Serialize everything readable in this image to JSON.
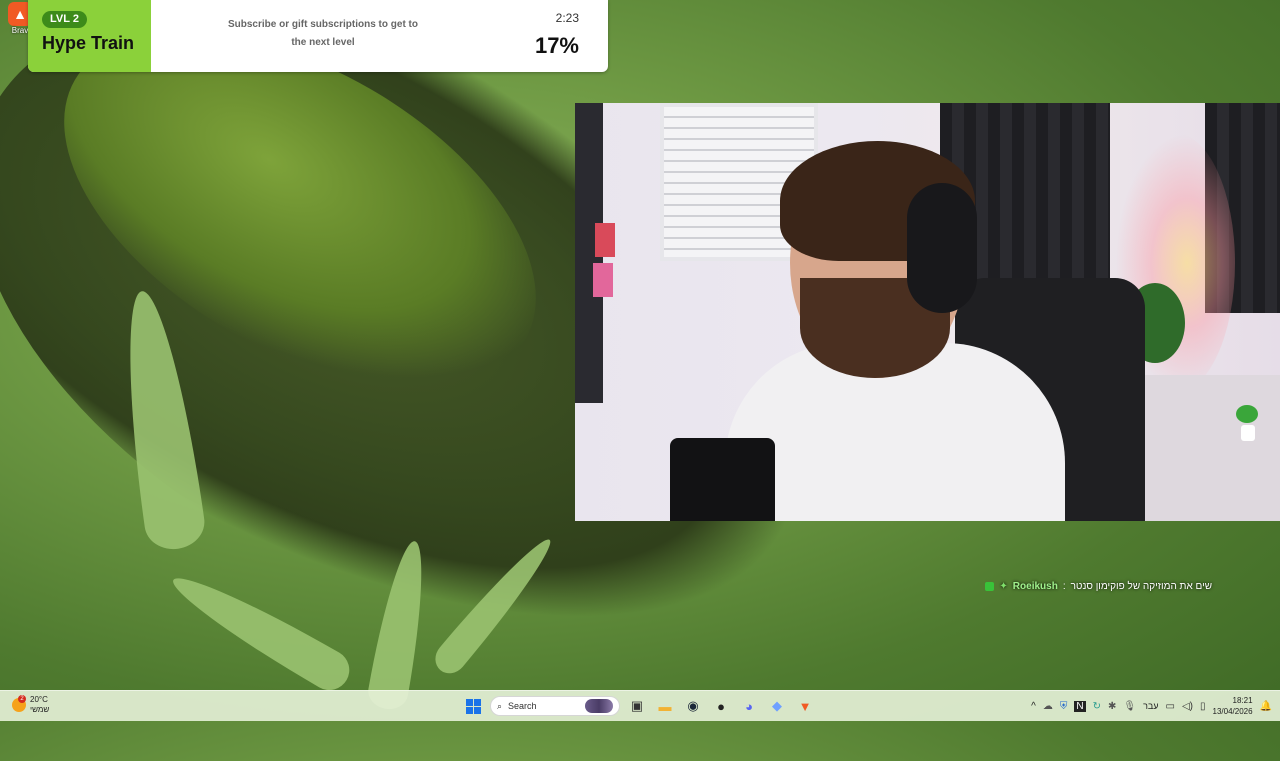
{
  "desktop": {
    "brave_icon_label": "Brav"
  },
  "hype_train": {
    "level_badge": "LVL 2",
    "title": "Hype Train",
    "description_line1": "Subscribe or gift subscriptions to get to",
    "description_line2": "the next level",
    "timer": "2:23",
    "percent_label": "17%",
    "progress_fraction": 0.17,
    "accent_color": "#8bd13a"
  },
  "webcam": {
    "description": "streamer webcam overlay"
  },
  "chat": {
    "username": "Roeikush",
    "separator": ":",
    "message": "שים את המוזיקה של פוקימון סנטר"
  },
  "taskbar": {
    "weather_temp": "20°C",
    "weather_desc": "שמשי",
    "weather_alert": "2",
    "search_placeholder": "Search",
    "apps": [
      "windows-start",
      "search",
      "task-view",
      "file-explorer",
      "steam",
      "obs",
      "discord",
      "app-diamond",
      "brave"
    ],
    "tray": {
      "language": "עבר",
      "time": "18:21",
      "date": "13/04/2026"
    }
  }
}
